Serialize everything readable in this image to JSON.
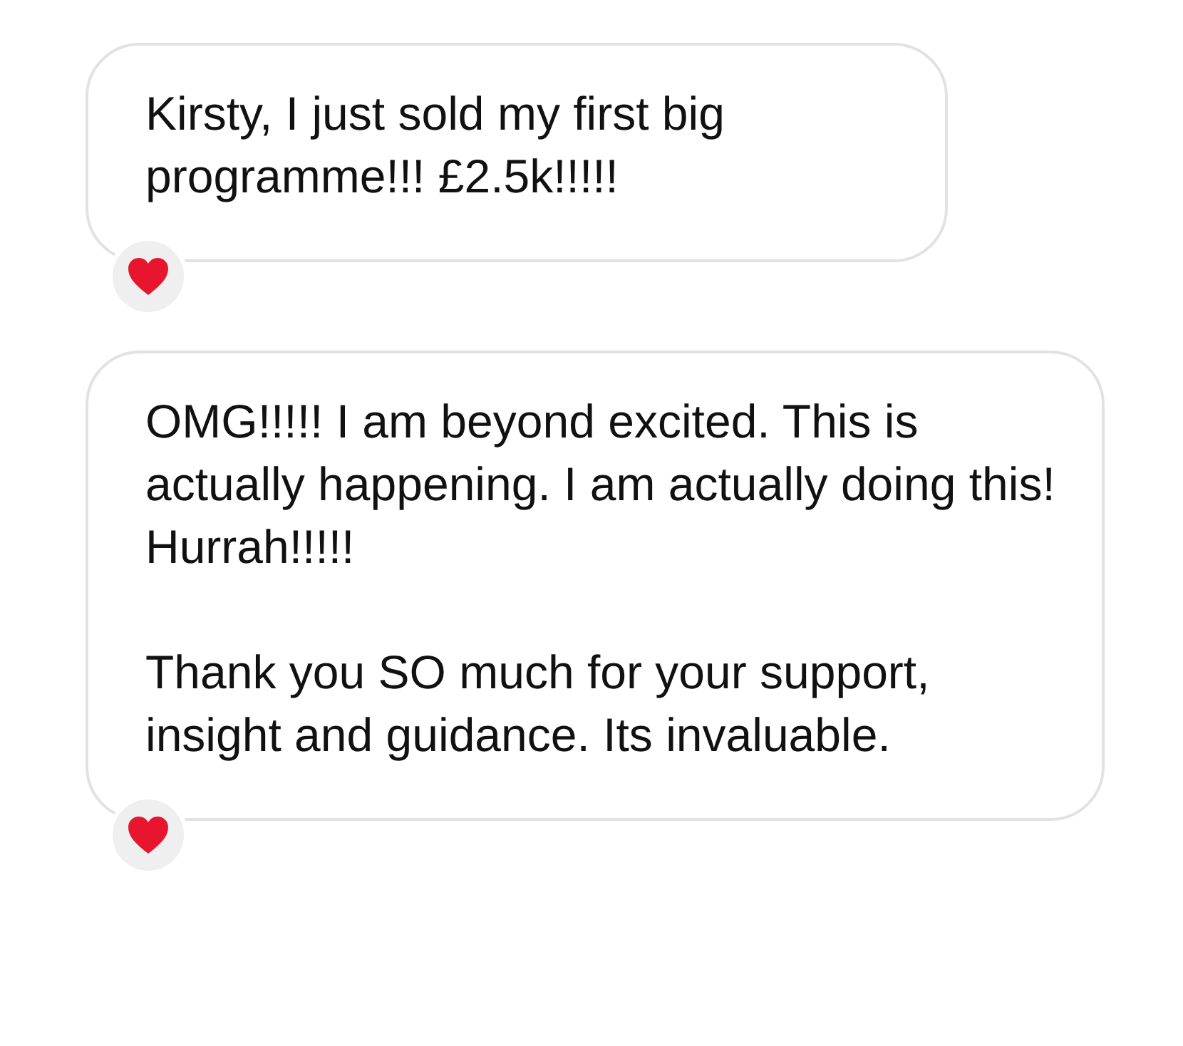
{
  "messages": [
    {
      "paragraphs": [
        "Kirsty, I just sold my first big programme!!! £2.5k!!!!!"
      ],
      "reacted": true
    },
    {
      "paragraphs": [
        "OMG!!!!! I am beyond excited. This is actually happening. I am actually doing this! Hurrah!!!!!",
        "Thank you SO much for your support, insight and guidance. Its invaluable."
      ],
      "reacted": true
    }
  ]
}
